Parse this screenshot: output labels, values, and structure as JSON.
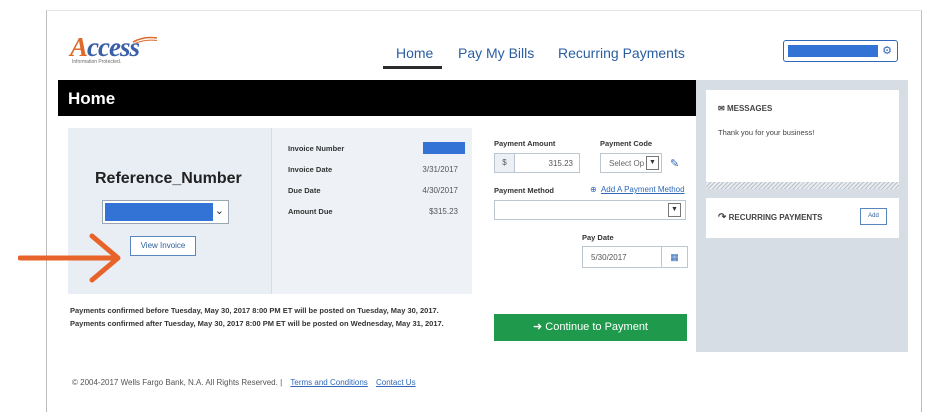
{
  "header": {
    "logo_initial": "A",
    "logo_rest": "ccess",
    "logo_tagline": "Information Protected.",
    "nav": [
      {
        "label": "Home"
      },
      {
        "label": "Pay My Bills"
      },
      {
        "label": "Recurring Payments"
      }
    ]
  },
  "page": {
    "title": "Home"
  },
  "reference": {
    "title": "Reference_Number",
    "view_invoice_label": "View Invoice"
  },
  "invoice": {
    "number_label": "Invoice Number",
    "date_label": "Invoice Date",
    "date_value": "3/31/2017",
    "due_label": "Due Date",
    "due_value": "4/30/2017",
    "amount_label": "Amount Due",
    "amount_value": "$315.23"
  },
  "payment": {
    "amount_label": "Payment Amount",
    "amount_currency": "$",
    "amount_value": "315.23",
    "code_label": "Payment Code",
    "code_placeholder": "Select Op",
    "method_label": "Payment Method",
    "add_method_label": "Add A Payment Method",
    "pay_date_label": "Pay Date",
    "pay_date_value": "5/30/2017"
  },
  "notices": [
    "Payments confirmed before Tuesday, May 30, 2017 8:00 PM ET will be posted on Tuesday, May 30, 2017.",
    "Payments confirmed after Tuesday, May 30, 2017 8:00 PM ET will be posted on Wednesday, May 31, 2017."
  ],
  "continue_label": "Continue to Payment",
  "sidebar": {
    "messages_title": "MESSAGES",
    "messages_body": "Thank you for your business!",
    "recurring_title": "RECURRING PAYMENTS",
    "add_label": "Add"
  },
  "footer": {
    "copyright": "© 2004-2017 Wells Fargo Bank, N.A. All Rights Reserved. |",
    "terms_label": "Terms and Conditions",
    "contact_label": "Contact Us"
  },
  "colors": {
    "accent_blue": "#2f68b8",
    "continue_green": "#1f9a4d",
    "arrow_orange": "#e8632a",
    "title_bar": "#000000"
  },
  "icons": {
    "gear": "gear-icon",
    "edit": "edit-icon",
    "add": "plus-circle-icon",
    "calendar": "calendar-icon",
    "envelope": "envelope-icon",
    "recurring": "recurring-icon",
    "continue": "arrow-circle-right-icon"
  }
}
